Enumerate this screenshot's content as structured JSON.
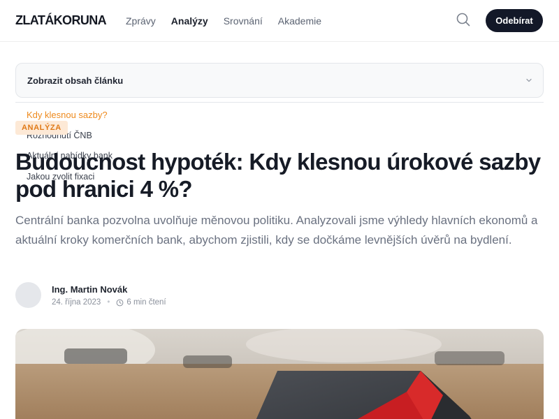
{
  "header": {
    "logo": "ZLATÁKORUNA",
    "nav": [
      {
        "label": "Zprávy"
      },
      {
        "label": "Analýzy"
      },
      {
        "label": "Srovnání"
      },
      {
        "label": "Akademie"
      }
    ],
    "search_icon": "search-icon",
    "subscribe_label": "Odebírat"
  },
  "reading_progress": 0.33,
  "toc": {
    "title": "Zobrazit obsah článku",
    "chevron_icon": "chevron-down-icon",
    "items": [
      {
        "label": "Kdy klesnou sazby?"
      },
      {
        "label": "Rozhodnutí ČNB"
      },
      {
        "label": "Aktuální nabídky bank"
      },
      {
        "label": "Jakou zvolit fixaci"
      }
    ]
  },
  "article": {
    "badge": "ANALÝZA",
    "title": "Budoucnost hypoték: Kdy klesnou úrokové sazby pod hranici 4 %?",
    "lead": "Centrální banka pozvolna uvolňuje měnovou politiku. Analyzovali jsme výhledy hlavních ekonomů a aktuální kroky komerčních bank, abychom zjistili, kdy se dočkáme levnějších úvěrů na bydlení.",
    "author": "Ing. Martin Novák",
    "date": "24. října 2023",
    "read_time": "6 min čtení"
  },
  "colors": {
    "accent": "#f08a1c",
    "dark": "#131828",
    "badge_bg": "#fde9d6"
  }
}
